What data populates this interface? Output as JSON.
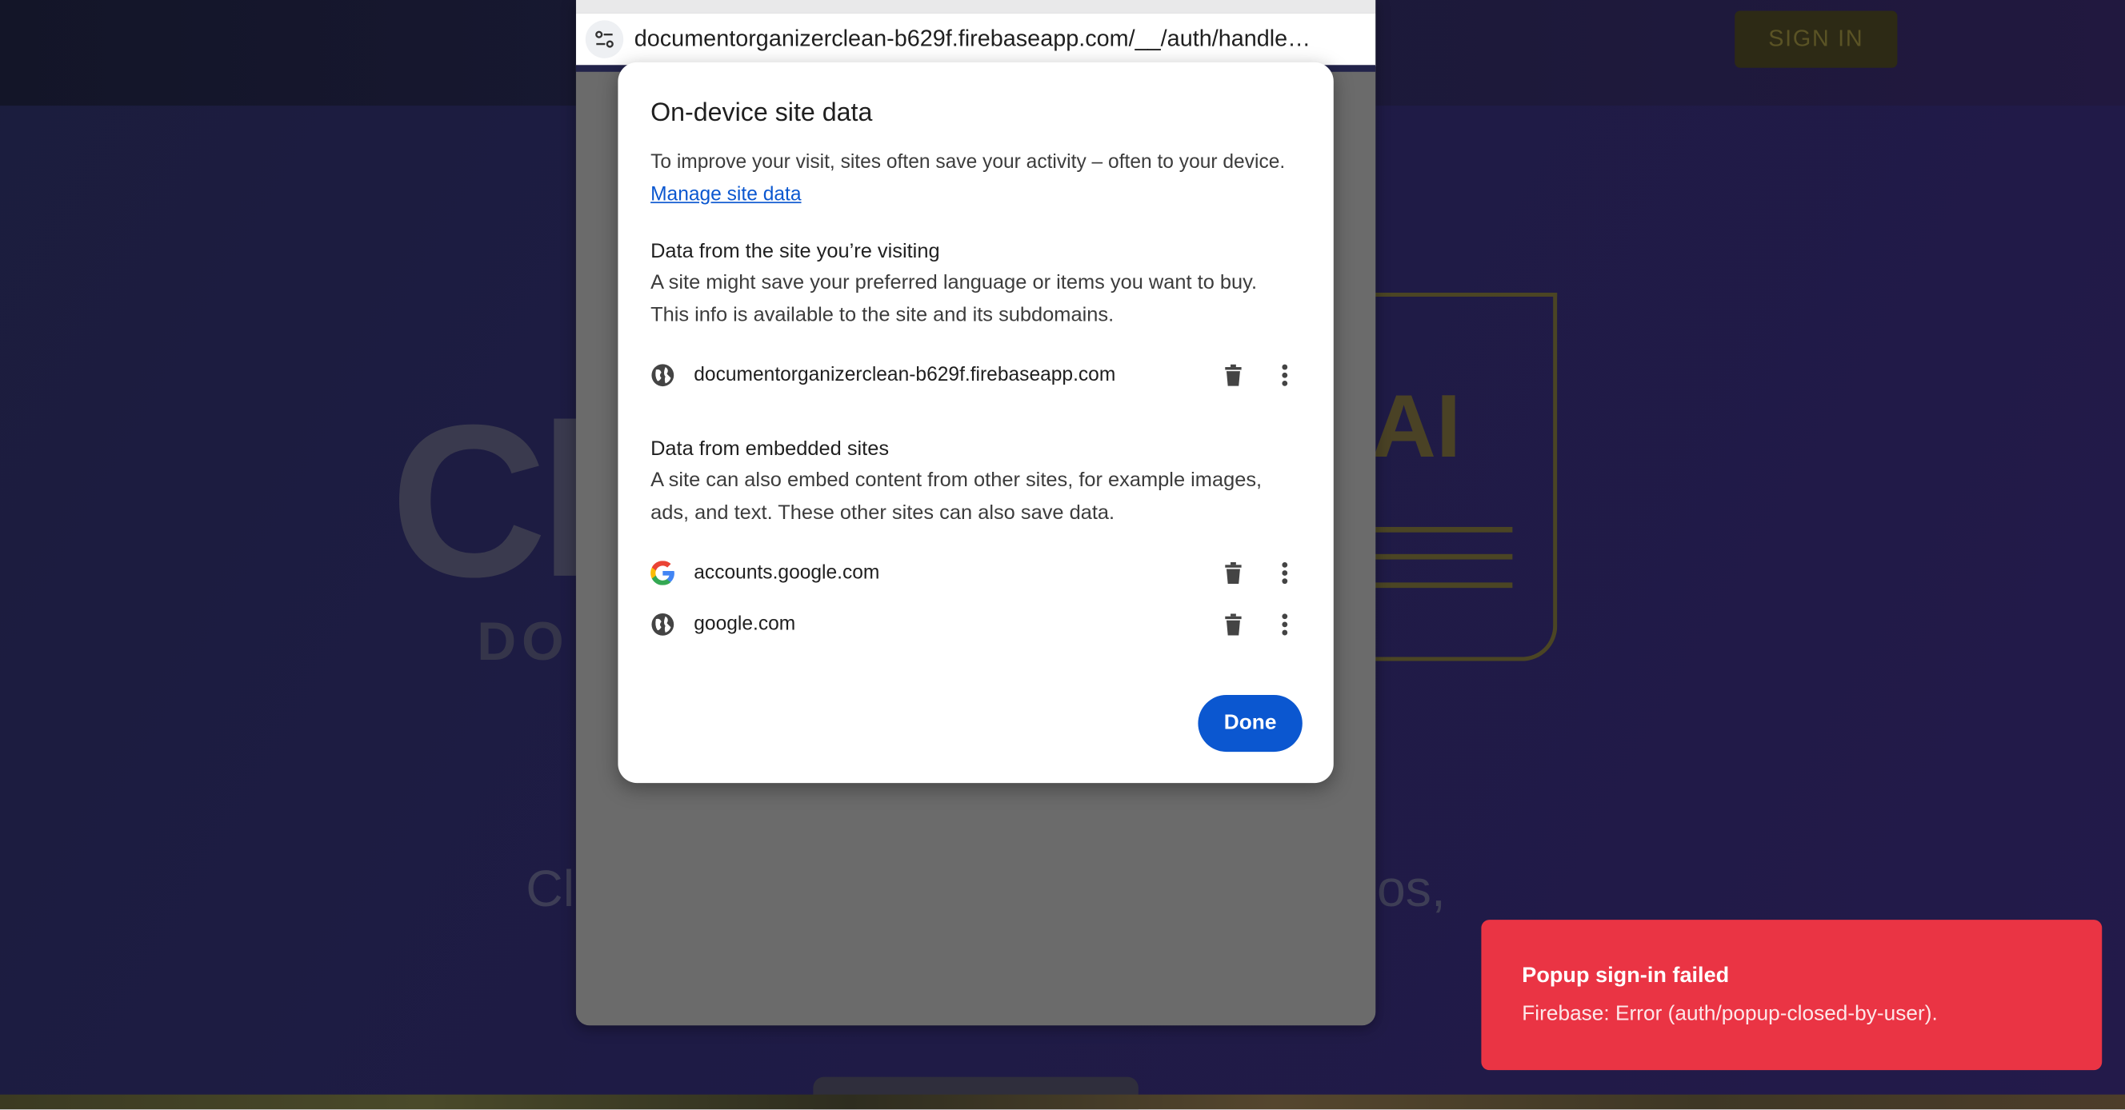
{
  "background_page": {
    "sign_in_label": "SIGN IN",
    "logo_fragment": "Cl",
    "logo_sub_fragment": "DO",
    "doc_badge": "AI",
    "tagline_left": "Cl",
    "tagline_right": "os,"
  },
  "popup": {
    "url": "documentorganizerclean-b629f.firebaseapp.com/__/auth/handle…",
    "site_settings_icon": "tune-icon"
  },
  "dialog": {
    "title": "On-device site data",
    "description": "To improve your visit, sites often save your activity – often to your device.",
    "manage_link": "Manage site data",
    "section_visiting": {
      "heading": "Data from the site you’re visiting",
      "body": "A site might save your preferred language or items you want to buy. This info is available to the site and its subdomains.",
      "sites": [
        {
          "name": "documentorganizerclean-b629f.firebaseapp.com",
          "icon": "globe-icon"
        }
      ]
    },
    "section_embedded": {
      "heading": "Data from embedded sites",
      "body": "A site can also embed content from other sites, for example images, ads, and text. These other sites can also save data.",
      "sites": [
        {
          "name": "accounts.google.com",
          "icon": "google-g-icon"
        },
        {
          "name": "google.com",
          "icon": "globe-icon"
        }
      ]
    },
    "delete_icon": "trash-icon",
    "more_icon": "more-vert-icon",
    "done_label": "Done"
  },
  "toast": {
    "title": "Popup sign-in failed",
    "message": "Firebase: Error (auth/popup-closed-by-user).",
    "color": "#ea3444"
  },
  "colors": {
    "accent": "#0b57d0",
    "error": "#ea3444"
  }
}
